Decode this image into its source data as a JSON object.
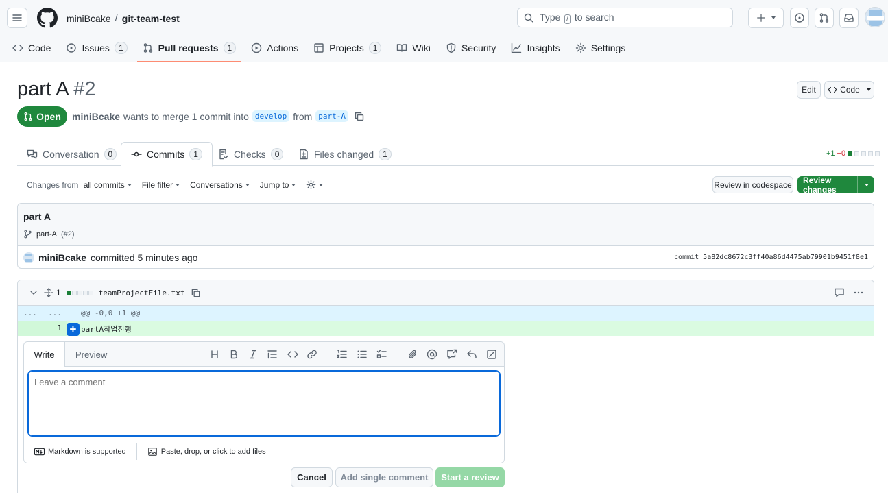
{
  "header": {
    "owner": "miniBcake",
    "separator": "/",
    "repo": "git-team-test",
    "search_pre": "Type",
    "search_key": "/",
    "search_post": "to search"
  },
  "repo_tabs": [
    {
      "label": "Code",
      "icon": "code-icon"
    },
    {
      "label": "Issues",
      "icon": "issue-opened-icon",
      "count": "1"
    },
    {
      "label": "Pull requests",
      "icon": "git-pull-request-icon",
      "count": "1",
      "selected": true
    },
    {
      "label": "Actions",
      "icon": "play-icon"
    },
    {
      "label": "Projects",
      "icon": "table-icon",
      "count": "1"
    },
    {
      "label": "Wiki",
      "icon": "book-icon"
    },
    {
      "label": "Security",
      "icon": "shield-icon"
    },
    {
      "label": "Insights",
      "icon": "graph-icon"
    },
    {
      "label": "Settings",
      "icon": "gear-icon"
    }
  ],
  "pr": {
    "title": "part A",
    "number": "#2",
    "edit_label": "Edit",
    "code_label": "Code",
    "state": "Open",
    "author": "miniBcake",
    "merge_text": "wants to merge 1 commit into",
    "base_branch": "develop",
    "from_text": "from",
    "head_branch": "part-A"
  },
  "pr_tabs": [
    {
      "label": "Conversation",
      "count": "0"
    },
    {
      "label": "Commits",
      "count": "1",
      "selected": true
    },
    {
      "label": "Checks",
      "count": "0"
    },
    {
      "label": "Files changed",
      "count": "1"
    }
  ],
  "diffstat": {
    "added": "+1",
    "removed": "−0"
  },
  "filters": {
    "changes_from": "Changes from",
    "all_commits": "all commits",
    "file_filter": "File filter",
    "conversations": "Conversations",
    "jump_to": "Jump to"
  },
  "actions": {
    "review_codespace": "Review in codespace",
    "review_changes": "Review changes"
  },
  "commit": {
    "title": "part A",
    "branch": "part-A",
    "pr_ref": "(#2)",
    "author": "miniBcake",
    "meta": "committed 5 minutes ago",
    "sha": "commit 5a82dc8672c3ff40a86d4475ab79901b9451f8e1"
  },
  "file": {
    "change_count": "1",
    "name": "teamProjectFile.txt",
    "hunk_gutter_a": "...",
    "hunk_gutter_b": "...",
    "hunk": "@@ -0,0 +1 @@",
    "line_number": "1",
    "plus": "+",
    "line_text": "partA작업진행"
  },
  "comment": {
    "write_tab": "Write",
    "preview_tab": "Preview",
    "placeholder": "Leave a comment",
    "markdown_note": "Markdown is supported",
    "attach_note": "Paste, drop, or click to add files",
    "cancel": "Cancel",
    "add_single": "Add single comment",
    "start_review": "Start a review"
  },
  "colors": {
    "green": "#1f883d",
    "accent": "#0969da",
    "underline": "#fd8c73"
  }
}
